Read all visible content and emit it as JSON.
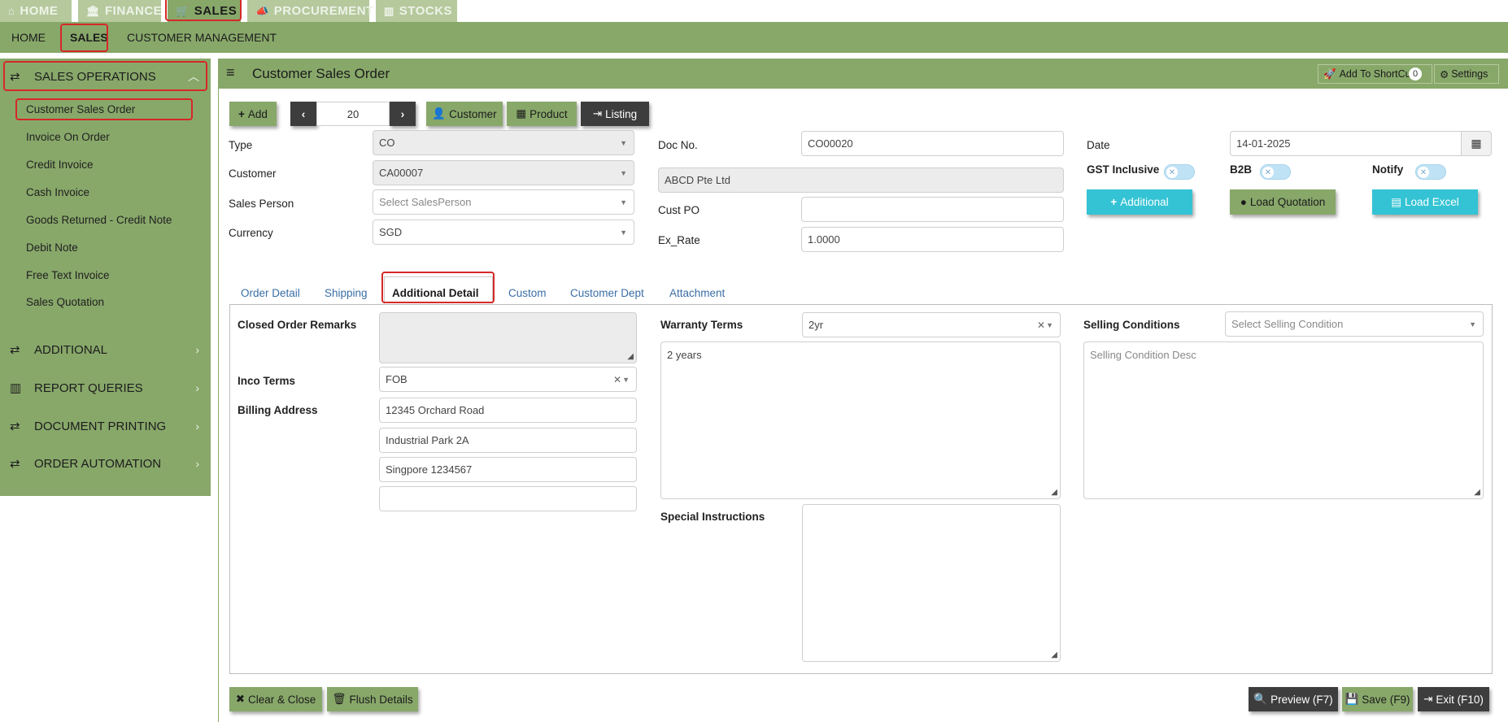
{
  "topnav": {
    "tabs": [
      {
        "label": "HOME",
        "icon": "home-icon"
      },
      {
        "label": "FINANCE",
        "icon": "bank-icon"
      },
      {
        "label": "SALES",
        "icon": "cart-icon"
      },
      {
        "label": "PROCUREMENT",
        "icon": "megaphone-icon"
      },
      {
        "label": "STOCKS",
        "icon": "bar-chart-icon"
      }
    ],
    "active": "SALES"
  },
  "subnav": {
    "items": [
      "HOME",
      "SALES",
      "CUSTOMER MANAGEMENT"
    ],
    "active": "SALES"
  },
  "sidebar": {
    "sections": [
      {
        "label": "SALES OPERATIONS",
        "expanded": true,
        "items": [
          "Customer Sales Order",
          "Invoice On Order",
          "Credit Invoice",
          "Cash Invoice",
          "Goods Returned - Credit Note",
          "Debit Note",
          "Free Text Invoice",
          "Sales Quotation"
        ]
      },
      {
        "label": "ADDITIONAL"
      },
      {
        "label": "REPORT QUERIES"
      },
      {
        "label": "DOCUMENT PRINTING"
      },
      {
        "label": "ORDER AUTOMATION"
      }
    ],
    "active_item": "Customer Sales Order"
  },
  "header": {
    "title": "Customer Sales Order",
    "shortcut_label": "Add To ShortCut",
    "shortcut_count": "0",
    "settings_label": "Settings"
  },
  "toolbar": {
    "add_label": "Add",
    "record_number": "20",
    "customer_label": "Customer",
    "product_label": "Product",
    "listing_label": "Listing"
  },
  "form": {
    "type_label": "Type",
    "type_value": "CO",
    "customer_label": "Customer",
    "customer_value": "CA00007",
    "salesperson_label": "Sales Person",
    "salesperson_placeholder": "Select SalesPerson",
    "currency_label": "Currency",
    "currency_value": "SGD",
    "docno_label": "Doc No.",
    "docno_value": "CO00020",
    "customer_name": "ABCD Pte Ltd",
    "custpo_label": "Cust PO",
    "custpo_value": "",
    "exrate_label": "Ex_Rate",
    "exrate_value": "1.0000",
    "date_label": "Date",
    "date_value": "14-01-2025",
    "gst_label": "GST Inclusive",
    "b2b_label": "B2B",
    "notify_label": "Notify",
    "additional_btn": "Additional",
    "load_quotation_btn": "Load Quotation",
    "load_excel_btn": "Load Excel"
  },
  "tabs": [
    "Order Detail",
    "Shipping",
    "Additional Detail",
    "Custom",
    "Customer Dept",
    "Attachment"
  ],
  "active_tab": "Additional Detail",
  "additional": {
    "closed_remarks_label": "Closed Order Remarks",
    "inco_label": "Inco Terms",
    "inco_value": "FOB",
    "billing_label": "Billing Address",
    "billing_lines": [
      "12345 Orchard Road",
      "Industrial Park 2A",
      "Singpore 1234567",
      ""
    ],
    "warranty_label": "Warranty Terms",
    "warranty_value": "2yr",
    "warranty_desc": "2 years",
    "special_label": "Special Instructions",
    "selling_label": "Selling Conditions",
    "selling_placeholder": "Select Selling Condition",
    "selling_desc_placeholder": "Selling Condition Desc"
  },
  "footer": {
    "clear_label": "Clear & Close",
    "flush_label": "Flush Details",
    "preview_label": "Preview (F7)",
    "save_label": "Save (F9)",
    "exit_label": "Exit (F10)"
  },
  "colors": {
    "brand_green": "#88a86a",
    "teal": "#33c3d4",
    "dark": "#3d3d3d",
    "highlight": "#d62828"
  }
}
